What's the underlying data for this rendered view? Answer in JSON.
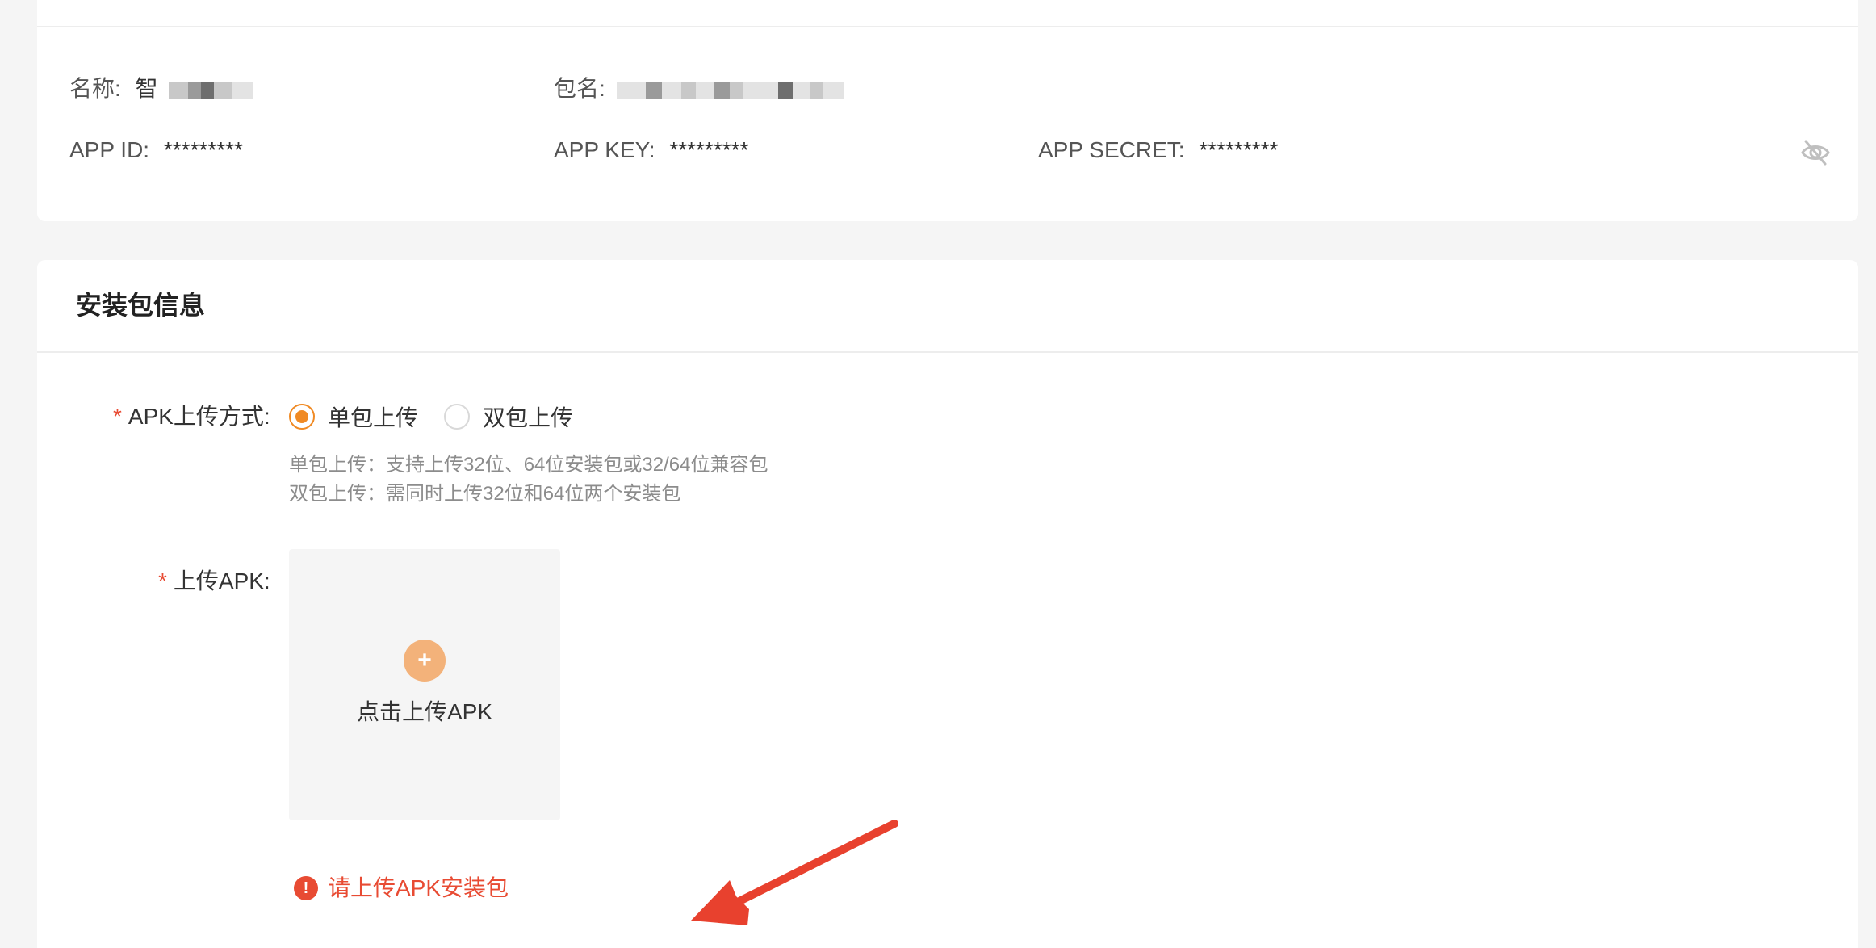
{
  "app_info": {
    "name_label": "名称:",
    "name_value_visible": "智",
    "package_label": "包名:",
    "app_id_label": "APP ID:",
    "app_id_value": "*********",
    "app_key_label": "APP KEY:",
    "app_key_value": "*********",
    "app_secret_label": "APP SECRET:",
    "app_secret_value": "*********",
    "toggle_visibility_icon": "eye-off-icon"
  },
  "install_package": {
    "section_title": "安装包信息",
    "upload_mode": {
      "required_mark": "*",
      "label": "APK上传方式:",
      "options": [
        {
          "label": "单包上传",
          "selected": true
        },
        {
          "label": "双包上传",
          "selected": false
        }
      ],
      "hints": [
        "单包上传：支持上传32位、64位安装包或32/64位兼容包",
        "双包上传：需同时上传32位和64位两个安装包"
      ]
    },
    "upload_apk": {
      "required_mark": "*",
      "label": "上传APK:",
      "plus_symbol": "+",
      "button_text": "点击上传APK"
    },
    "error": {
      "icon_symbol": "!",
      "message": "请上传APK安装包"
    }
  },
  "colors": {
    "accent": "#f08a24",
    "accent_light": "#f3b27a",
    "error": "#e84b33",
    "annotation_arrow": "#e8412e"
  }
}
